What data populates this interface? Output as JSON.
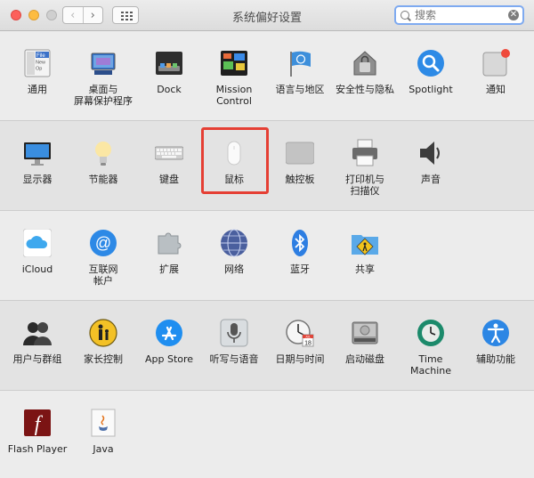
{
  "window": {
    "title": "系统偏好设置",
    "back_glyph": "‹",
    "forward_glyph": "›"
  },
  "search": {
    "placeholder": "搜索",
    "value": ""
  },
  "selected_pane": "鼠标",
  "sections": [
    {
      "items": [
        {
          "label": "通用",
          "icon": "general-icon"
        },
        {
          "label": "桌面与\n屏幕保护程序",
          "icon": "desktop-screensaver-icon"
        },
        {
          "label": "Dock",
          "icon": "dock-icon"
        },
        {
          "label": "Mission\nControl",
          "icon": "mission-control-icon"
        },
        {
          "label": "语言与地区",
          "icon": "language-region-icon"
        },
        {
          "label": "安全性与隐私",
          "icon": "security-privacy-icon"
        },
        {
          "label": "Spotlight",
          "icon": "spotlight-icon"
        },
        {
          "label": "通知",
          "icon": "notifications-icon"
        }
      ]
    },
    {
      "items": [
        {
          "label": "显示器",
          "icon": "displays-icon"
        },
        {
          "label": "节能器",
          "icon": "energy-saver-icon"
        },
        {
          "label": "键盘",
          "icon": "keyboard-icon"
        },
        {
          "label": "鼠标",
          "icon": "mouse-icon"
        },
        {
          "label": "触控板",
          "icon": "trackpad-icon"
        },
        {
          "label": "打印机与\n扫描仪",
          "icon": "printers-scanners-icon"
        },
        {
          "label": "声音",
          "icon": "sound-icon"
        }
      ]
    },
    {
      "items": [
        {
          "label": "iCloud",
          "icon": "icloud-icon"
        },
        {
          "label": "互联网\n帐户",
          "icon": "internet-accounts-icon"
        },
        {
          "label": "扩展",
          "icon": "extensions-icon"
        },
        {
          "label": "网络",
          "icon": "network-icon"
        },
        {
          "label": "蓝牙",
          "icon": "bluetooth-icon"
        },
        {
          "label": "共享",
          "icon": "sharing-icon"
        }
      ]
    },
    {
      "items": [
        {
          "label": "用户与群组",
          "icon": "users-groups-icon"
        },
        {
          "label": "家长控制",
          "icon": "parental-controls-icon"
        },
        {
          "label": "App Store",
          "icon": "app-store-icon"
        },
        {
          "label": "听写与语音",
          "icon": "dictation-speech-icon"
        },
        {
          "label": "日期与时间",
          "icon": "date-time-icon"
        },
        {
          "label": "启动磁盘",
          "icon": "startup-disk-icon"
        },
        {
          "label": "Time Machine",
          "icon": "time-machine-icon"
        },
        {
          "label": "辅助功能",
          "icon": "accessibility-icon"
        }
      ]
    },
    {
      "items": [
        {
          "label": "Flash Player",
          "icon": "flash-player-icon"
        },
        {
          "label": "Java",
          "icon": "java-icon"
        }
      ]
    }
  ],
  "icon_text": {
    "general_file": "File",
    "general_new": "New",
    "general_op": "Op",
    "calendar_month": "JUL",
    "calendar_day": "18",
    "flash_glyph": "f"
  },
  "colors": {
    "highlight_border": "#e53f34",
    "search_focus": "#7eaaf0",
    "notification_badge": "#ef4a3c"
  }
}
